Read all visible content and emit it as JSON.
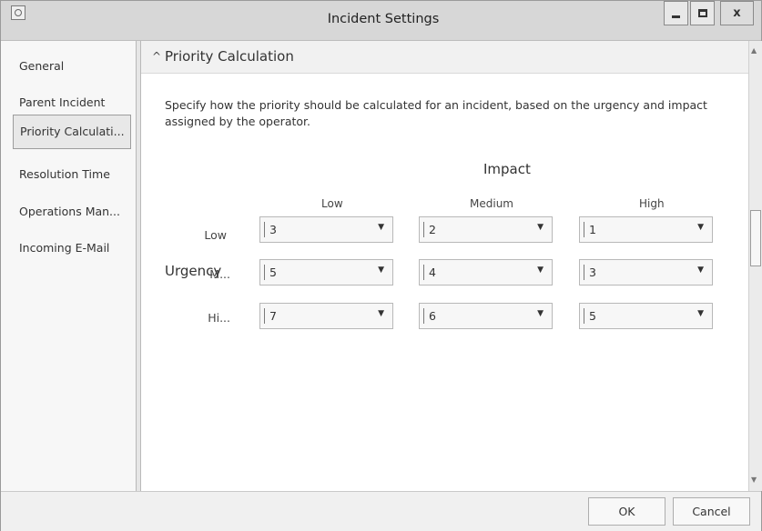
{
  "window": {
    "title": "Incident Settings",
    "close_label": "x"
  },
  "sidebar": {
    "items": [
      {
        "label": "General",
        "selected": false
      },
      {
        "label": "Parent Incident",
        "selected": false
      },
      {
        "label": "Priority Calculati...",
        "selected": true
      },
      {
        "label": "Resolution Time",
        "selected": false
      },
      {
        "label": "Operations Man...",
        "selected": false
      },
      {
        "label": "Incoming E-Mail",
        "selected": false
      }
    ]
  },
  "section": {
    "chevron": "^",
    "title": "Priority Calculation",
    "description": "Specify how the priority should be calculated for an incident, based on the urgency and impact assigned by the operator."
  },
  "matrix": {
    "impact_title": "Impact",
    "urgency_title": "Urgency",
    "columns": [
      "Low",
      "Medium",
      "High"
    ],
    "rows": [
      {
        "label": "Low",
        "values": [
          "3",
          "2",
          "1"
        ]
      },
      {
        "label": "M...",
        "values": [
          "5",
          "4",
          "3"
        ]
      },
      {
        "label": "Hi...",
        "values": [
          "7",
          "6",
          "5"
        ]
      }
    ]
  },
  "footer": {
    "ok_label": "OK",
    "cancel_label": "Cancel"
  },
  "icons": {
    "dropdown": "chevron-down-icon",
    "collapse": "chevron-up-icon",
    "minimize": "minimize-icon",
    "maximize": "maximize-icon",
    "close": "close-icon",
    "app": "app-icon"
  }
}
